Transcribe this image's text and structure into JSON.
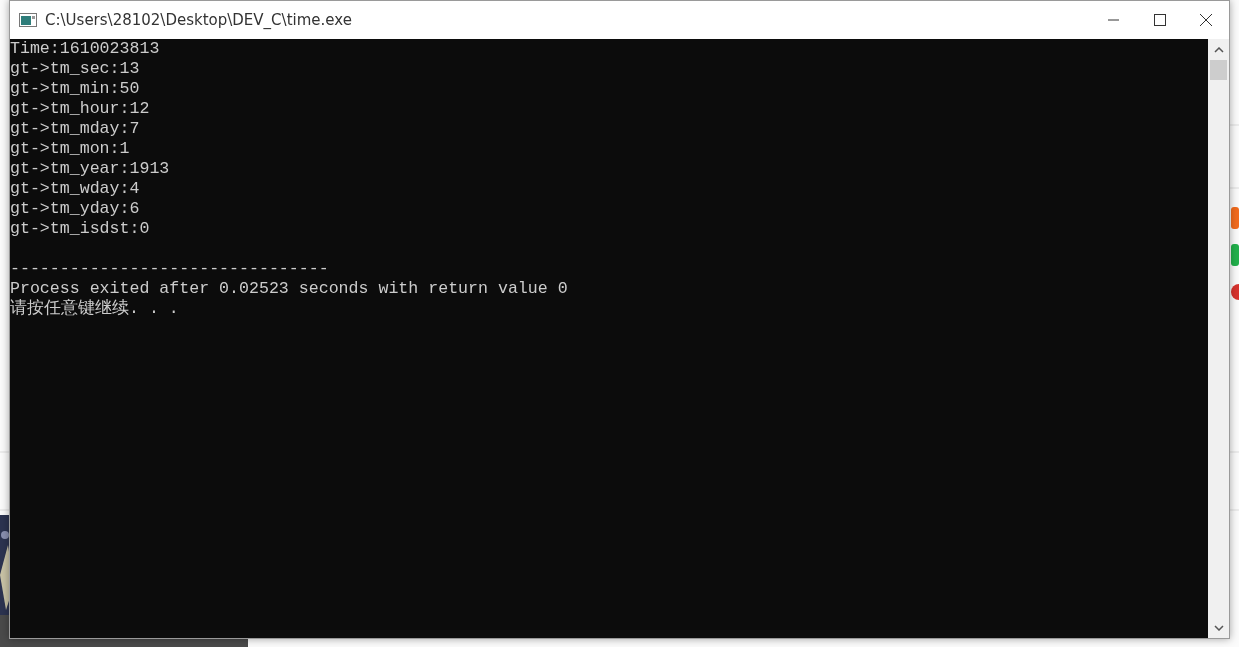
{
  "window": {
    "title": "C:\\Users\\28102\\Desktop\\DEV_C\\time.exe"
  },
  "console": {
    "lines": [
      {
        "text": "Time:1610023813"
      },
      {
        "text": "gt->tm_sec:13"
      },
      {
        "text": "gt->tm_min:50"
      },
      {
        "text": "gt->tm_hour:12"
      },
      {
        "text": "gt->tm_mday:7"
      },
      {
        "text": "gt->tm_mon:1"
      },
      {
        "text": "gt->tm_year:1913"
      },
      {
        "text": "gt->tm_wday:4"
      },
      {
        "text": "gt->tm_yday:6"
      },
      {
        "text": "gt->tm_isdst:0"
      },
      {
        "text": "--------------------------------",
        "blank_before": true
      },
      {
        "text": "Process exited after 0.02523 seconds with return value 0"
      },
      {
        "text": "请按任意键继续. . ."
      }
    ]
  }
}
